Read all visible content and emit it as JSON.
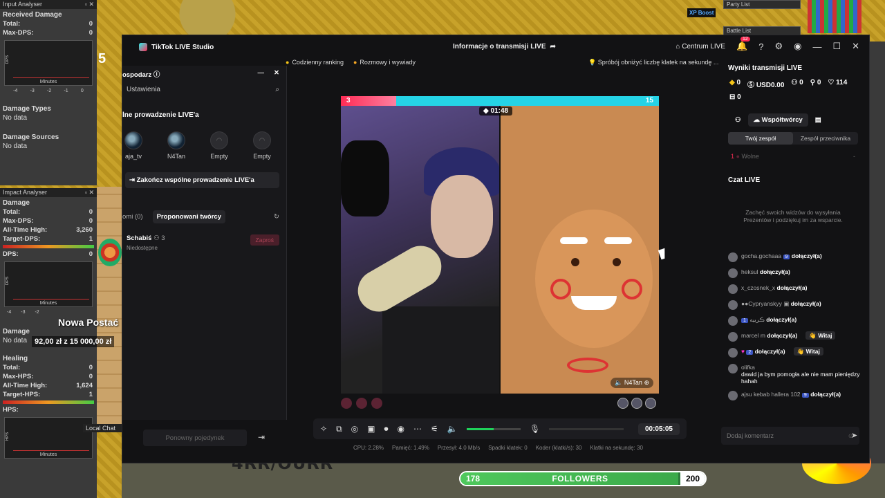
{
  "game": {
    "k5": "5",
    "nowa_postac": "Nowa Postać",
    "money": "92,00 zł z 15 000,00 zł",
    "bottom_text": "4RR/OURR",
    "local_chat": "Local Chat",
    "xp_boost": "XP Boost",
    "party_list": "Party List",
    "battle_list": "Battle List"
  },
  "input_analyser": {
    "header": "Input Analyser",
    "title": "Received Damage",
    "rows": [
      {
        "label": "Total:",
        "value": "0"
      },
      {
        "label": "Max-DPS:",
        "value": "0"
      }
    ],
    "graph_y": "DPS",
    "graph_x": "Minutes",
    "ticks": [
      "-4",
      "-3",
      "-2",
      "-1",
      "0"
    ],
    "damage_types": "Damage Types",
    "damage_types_value": "No data",
    "damage_sources": "Damage Sources",
    "damage_sources_value": "No data"
  },
  "impact_analyser": {
    "header": "Impact Analyser",
    "title": "Damage",
    "rows": [
      {
        "label": "Total:",
        "value": "0"
      },
      {
        "label": "Max-DPS:",
        "value": "0"
      },
      {
        "label": "All-Time High:",
        "value": "3,260"
      },
      {
        "label": "Target-DPS:",
        "value": "1"
      },
      {
        "label": "DPS:",
        "value": "0"
      }
    ],
    "graph_y": "DPS",
    "graph_x": "Minutes",
    "ticks": [
      "-4",
      "-3",
      "-2"
    ],
    "damage_label": "Damage",
    "damage_value": "No data",
    "healing": "Healing",
    "heal_rows": [
      {
        "label": "Total:",
        "value": "0"
      },
      {
        "label": "Max-HPS:",
        "value": "0"
      },
      {
        "label": "All-Time High:",
        "value": "1,624"
      },
      {
        "label": "Target-HPS:",
        "value": "1"
      },
      {
        "label": "HPS:",
        "value": ""
      }
    ],
    "graph2_y": "HPS",
    "graph2_x": "Minutes"
  },
  "tiktok": {
    "app_title": "TikTok LIVE Studio",
    "center_title": "Informacje o transmisji LIVE",
    "centrum": "Centrum LIVE",
    "notif_count": "12",
    "tabs": [
      "Codzienny ranking",
      "Rozmowy i wywiady"
    ],
    "tip": "Spróbój obniżyć liczbę klatek na sekundę ...",
    "cohost": {
      "header": "ospodarz",
      "search_label": "Ustawienia",
      "section": "lne prowadzenie LIVE'a",
      "avatars": [
        {
          "name": "aja_tv"
        },
        {
          "name": "N4Tan"
        },
        {
          "name": "Empty"
        },
        {
          "name": "Empty"
        }
      ],
      "end_button": "Zakończ wspólne prowadzenie LIVE'a",
      "subtab_1": "omi (0)",
      "subtab_2": "Proponowani twórcy",
      "creator_name": "Schabiś",
      "creator_count": "3",
      "creator_status": "Niedostępne",
      "invite": "Zaproś",
      "rematch": "Ponowny pojedynek"
    },
    "battle": {
      "left_score": "3",
      "right_score": "15",
      "timer": "01:48",
      "right_tag": "N4Tan"
    },
    "toolbar": {
      "elapsed": "00:05:05",
      "volume_level": 0.5
    },
    "stats": [
      "CPU: 2.28%",
      "Pamięć: 1.49%",
      "Przesył: 4.0 Mb/s",
      "Spadki klatek: 0",
      "Koder (klatki/s): 30",
      "Klatki na sekundę: 30"
    ],
    "results": {
      "title": "Wyniki transmisji LIVE",
      "diamonds": "0",
      "usd": "USD0.00",
      "viewers": "0",
      "gifters": "0",
      "likes": "114",
      "gifts": "0"
    },
    "cohosts_label": "Współtwórcy",
    "team_mine": "Twój zespół",
    "team_opp": "Zespół przeciwnika",
    "free_num": "1",
    "free_label": "Wolne",
    "free_dash": "-",
    "chat_title": "Czat LIVE",
    "chat_empty": "Zachęć swoich widzów do wysyłania Prezentów i podziękuj im za wsparcie.",
    "messages": [
      {
        "user": "gocha.gochaaa",
        "tag": "9",
        "text": "dołączył(a)",
        "witaj": ""
      },
      {
        "user": "heksul",
        "tag": "",
        "text": "dołączył(a)",
        "witaj": ""
      },
      {
        "user": "x_czosnek_x",
        "tag": "",
        "text": "dołączył(a)",
        "witaj": ""
      },
      {
        "user": "Cypryanskyy",
        "tag": "",
        "text": "dołączył(a)",
        "witaj": ""
      },
      {
        "user": "ڪربيه",
        "tag": "1",
        "text": "dołączył(a)",
        "witaj": ""
      },
      {
        "user": "marcel m",
        "tag": "",
        "text": "dołączył(a)",
        "witaj": "Witaj"
      },
      {
        "user": "",
        "tag": "2",
        "text": "dołączył(a)",
        "witaj": "Witaj"
      },
      {
        "user": "olifka",
        "tag": "",
        "text": "dawid ja bym pomogła ale nie mam pieniędzy hahah",
        "witaj": ""
      },
      {
        "user": "ajsu kebab hallera 102",
        "tag": "9",
        "text": "dołączył(a)",
        "witaj": ""
      }
    ],
    "comment_placeholder": "Dodaj komentarz"
  },
  "followers": {
    "current": "178",
    "label": "FOLLOWERS",
    "goal": "200",
    "progress": 0.89
  }
}
